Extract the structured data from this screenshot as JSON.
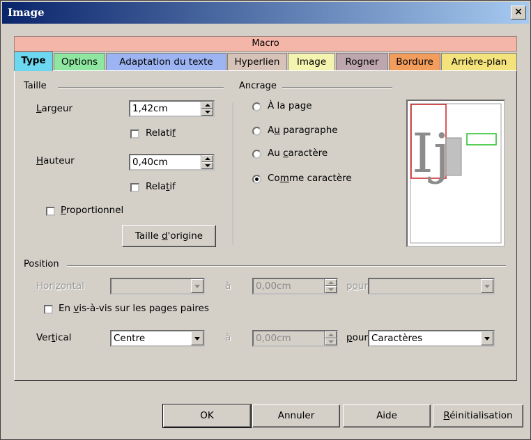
{
  "window": {
    "title": "Image",
    "close_glyph": "×"
  },
  "macro_label": "Macro",
  "tabs": [
    {
      "label": "Type",
      "color": "#6cd8f0",
      "active": true
    },
    {
      "label": "Options",
      "color": "#8ee6a0"
    },
    {
      "label": "Adaptation du texte",
      "color": "#9db4f2"
    },
    {
      "label": "Hyperlien",
      "color": "#d7c2b8"
    },
    {
      "label": "Image",
      "color": "#f4f4b0"
    },
    {
      "label": "Rogner",
      "color": "#bda6ad"
    },
    {
      "label": "Bordure",
      "color": "#f39d5c"
    },
    {
      "label": "Arrière-plan",
      "color": "#f4e27c"
    }
  ],
  "taille": {
    "group": "Taille",
    "largeur_label": "Largeur",
    "largeur_value": "1,42cm",
    "relatif_label_1": "Relatif",
    "hauteur_label": "Hauteur",
    "hauteur_value": "0,40cm",
    "relatif_label_2": "Relatif",
    "proportionnel_label": "Proportionnel",
    "original_button": "Taille d'origine"
  },
  "ancrage": {
    "group": "Ancrage",
    "options": [
      "À la page",
      "Au paragraphe",
      "Au caractère",
      "Comme caractère"
    ],
    "selected": "Comme caractère"
  },
  "preview": {
    "text": "Ij"
  },
  "position": {
    "group": "Position",
    "horizontal_label": "Horizontal",
    "horizontal_value": "",
    "a_label_1": "à",
    "h_offset": "0,00cm",
    "pour_label_1": "pour",
    "h_pour_value": "",
    "mirror_label": "En vis-à-vis sur les pages paires",
    "vertical_label": "Vertical",
    "vertical_value": "Centre",
    "a_label_2": "à",
    "v_offset": "0,00cm",
    "pour_label_2": "pour",
    "v_pour_value": "Caractères"
  },
  "buttons": {
    "ok": "OK",
    "cancel": "Annuler",
    "help": "Aide",
    "reset": "Réinitialisation"
  }
}
